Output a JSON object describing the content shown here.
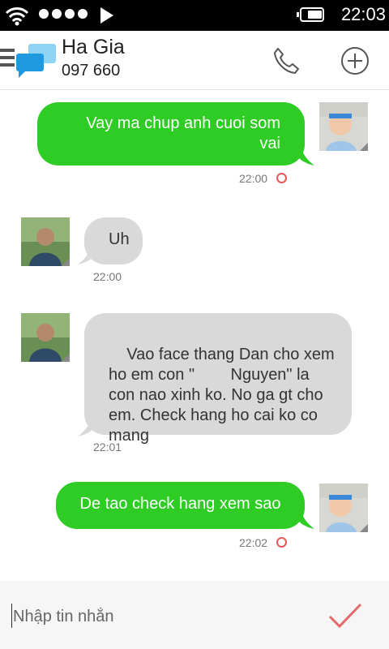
{
  "status_bar": {
    "time": "22:03"
  },
  "header": {
    "contact_name": "Ha Gia",
    "contact_phone": "097 660"
  },
  "messages": [
    {
      "direction": "out",
      "text": "Vay ma chup anh cuoi som vai",
      "time": "22:00"
    },
    {
      "direction": "in",
      "text": "Uh",
      "time": "22:00"
    },
    {
      "direction": "in",
      "text": "Vao face thang Dan cho xem ho em con \"        Nguyen\" la con nao xinh ko. No ga gt cho em. Check hang ho cai ko co mang",
      "time": "22:01"
    },
    {
      "direction": "out",
      "text": "De tao check hang xem sao",
      "time": "22:02"
    }
  ],
  "composer": {
    "placeholder": "Nhập tin nhắn"
  },
  "colors": {
    "outgoing_bubble": "#2ecc25",
    "incoming_bubble": "#d9d9d9",
    "status_ring": "#e35a5a",
    "send_check": "#e06a6a"
  }
}
